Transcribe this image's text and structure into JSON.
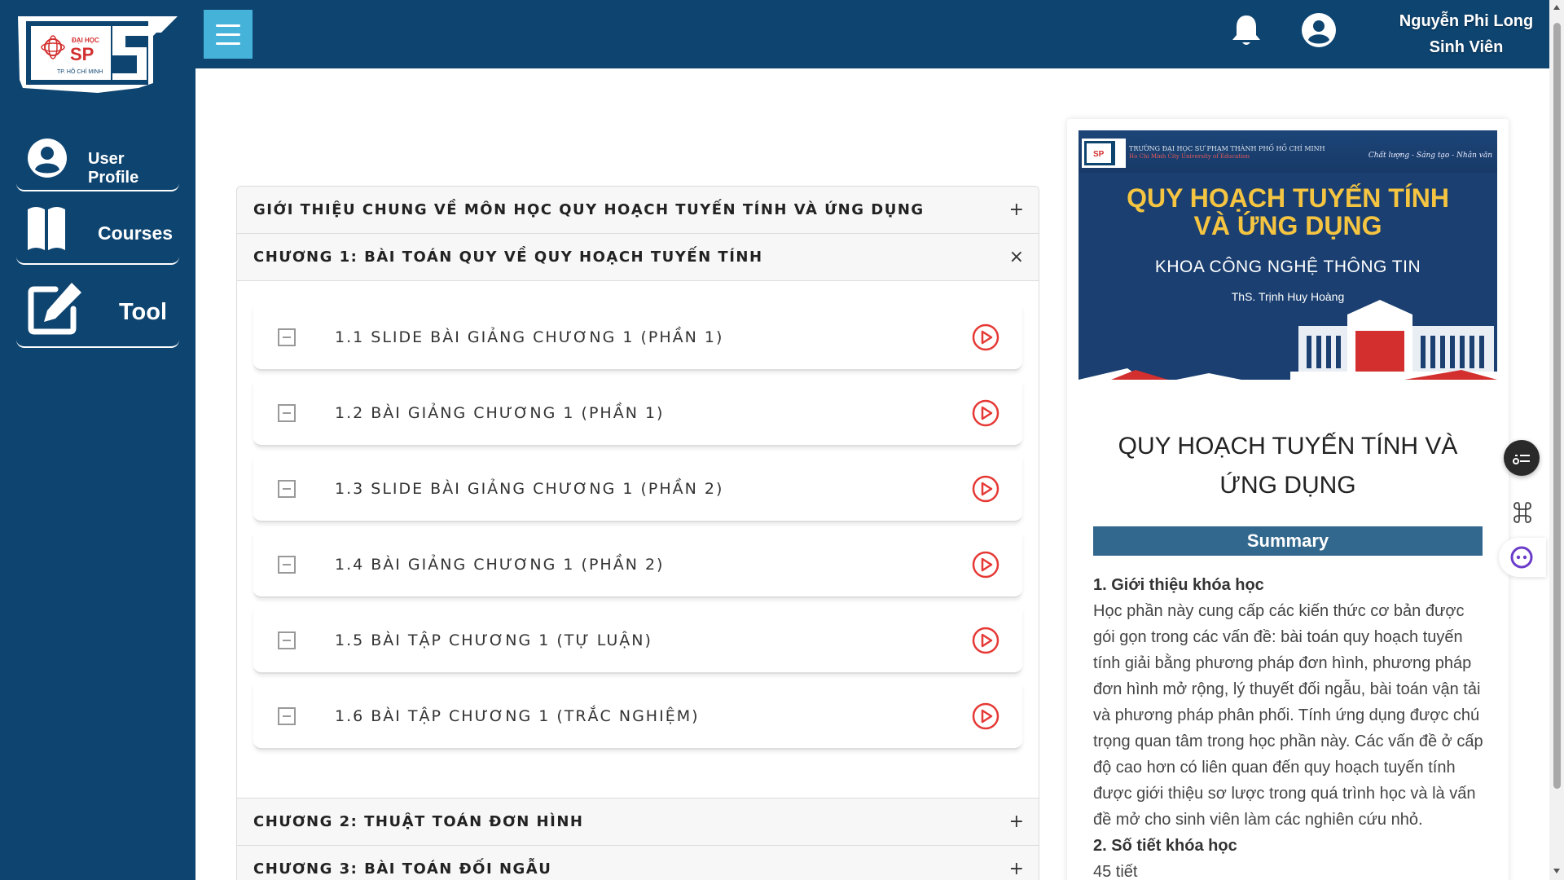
{
  "logo": {
    "line1": "ĐẠI HỌC",
    "line2": "SP",
    "line3": "TP. HỒ CHÍ MINH"
  },
  "sidebar": {
    "items": [
      {
        "label": "User Profile",
        "icon": "user-circle-icon"
      },
      {
        "label": "Courses",
        "icon": "book-icon"
      },
      {
        "label": "Tool",
        "icon": "edit-icon"
      }
    ]
  },
  "header": {
    "menu_icon": "hamburger-icon",
    "user_name": "Nguyễn Phi Long",
    "user_role": "Sinh Viên"
  },
  "accordion": {
    "sections": [
      {
        "title": "GIỚI THIỆU CHUNG VỀ MÔN HỌC QUY HOẠCH TUYẾN TÍNH VÀ ỨNG DỤNG",
        "icon": "+",
        "expanded": false
      },
      {
        "title": "CHƯƠNG 1: BÀI TOÁN QUY VỀ QUY HOẠCH TUYẾN TÍNH",
        "icon": "×",
        "expanded": true
      },
      {
        "title": "CHƯƠNG 2: THUẬT TOÁN ĐƠN HÌNH",
        "icon": "+",
        "expanded": false
      },
      {
        "title": "CHƯƠNG 3: BÀI TOÁN ĐỐI NGẪU",
        "icon": "+",
        "expanded": false
      }
    ],
    "lessons": [
      {
        "title": "1.1 SLIDE BÀI GIẢNG CHƯƠNG 1 (PHẦN 1)"
      },
      {
        "title": "1.2 BÀI GIẢNG CHƯƠNG 1 (PHẦN 1)"
      },
      {
        "title": "1.3 SLIDE BÀI GIẢNG CHƯƠNG 1 (PHẦN 2)"
      },
      {
        "title": "1.4 BÀI GIẢNG CHƯƠNG 1 (PHẦN 2)"
      },
      {
        "title": "1.5 BÀI TẬP CHƯƠNG 1 (TỰ LUẬN)"
      },
      {
        "title": "1.6 BÀI TẬP CHƯƠNG 1 (TRẮC NGHIỆM)"
      }
    ]
  },
  "course_card": {
    "banner": {
      "school": "TRƯỜNG ĐẠI HỌC SƯ PHẠM THÀNH PHỐ HỒ CHÍ MINH",
      "school_en": "Ho Chi Minh City University of Education",
      "slogan": "Chất lượng - Sáng tạo - Nhân văn",
      "title_line1": "QUY HOẠCH TUYẾN TÍNH",
      "title_line2": "VÀ ỨNG DỤNG",
      "faculty": "KHOA CÔNG NGHỆ THÔNG TIN",
      "teacher": "ThS. Trịnh Huy Hoàng"
    },
    "title": "QUY HOẠCH TUYẾN TÍNH VÀ ỨNG DỤNG",
    "summary_label": "Summary",
    "section1_heading": "1. Giới thiệu khóa học",
    "section1_text": "Học phần này cung cấp các kiến thức cơ bản được gói gọn trong các vấn đề: bài toán quy hoạch tuyến tính giải bằng phương pháp đơn hình, phương pháp đơn hình mở rộng, lý thuyết đối ngẫu, bài toán vận tải và phương pháp phân phối. Tính ứng dụng được chú trọng quan tâm trong học phần này. Các vấn đề ở cấp độ cao hơn có liên quan đến quy hoạch tuyến tính được giới thiệu sơ lược trong quá trình học và là vấn đề mở cho sinh viên làm các nghiên cứu nhỏ.",
    "section2_heading": "2. Số tiết khóa học",
    "section2_text": "45 tiết"
  },
  "colors": {
    "brand_navy": "#0e4470",
    "menu_button": "#45b3d9",
    "play_red": "#e53935",
    "summary_bar": "#33688e",
    "banner_gold": "#f5c542"
  }
}
